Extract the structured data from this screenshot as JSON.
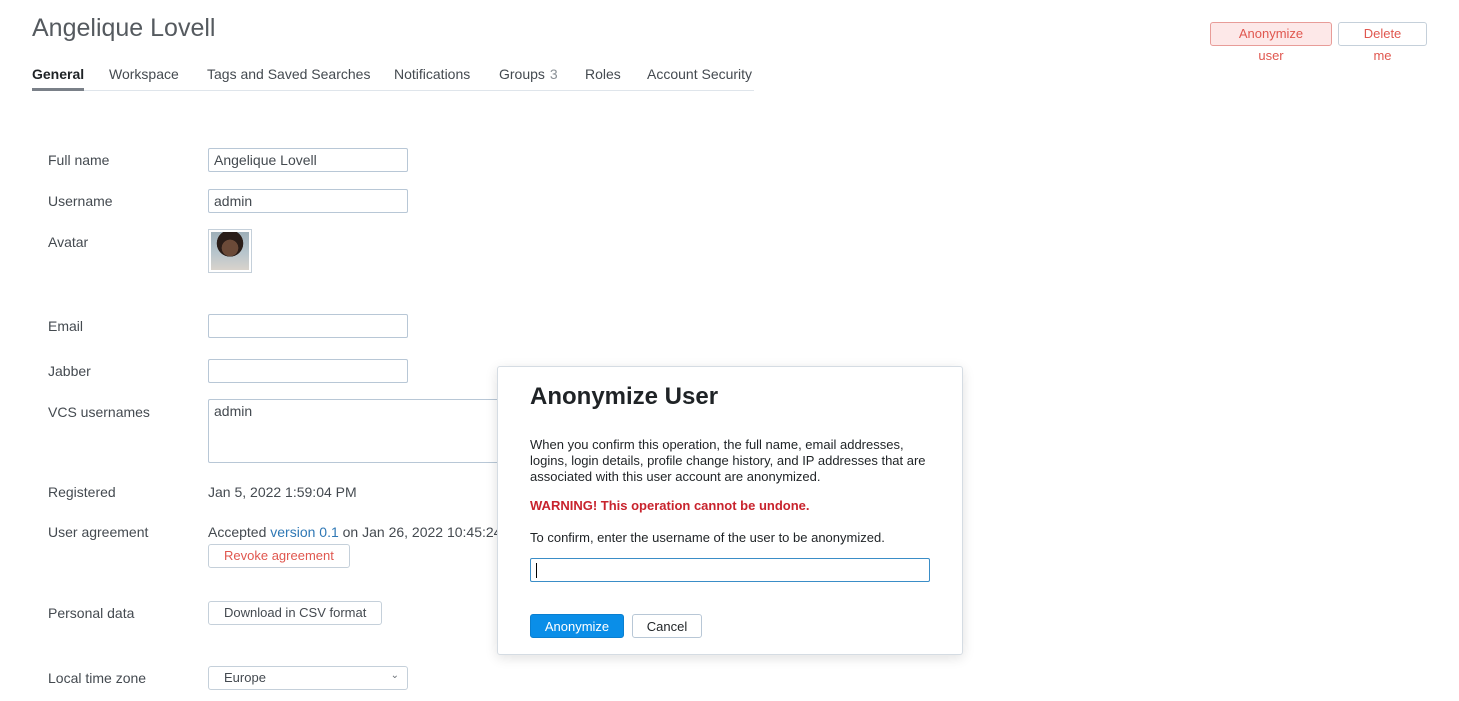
{
  "page": {
    "title": "Angelique Lovell"
  },
  "header_actions": {
    "anonymize_label": "Anonymize user",
    "delete_label": "Delete me"
  },
  "tabs": [
    {
      "label": "General",
      "active": true
    },
    {
      "label": "Workspace"
    },
    {
      "label": "Tags and Saved Searches"
    },
    {
      "label": "Notifications"
    },
    {
      "label": "Groups",
      "count": "3"
    },
    {
      "label": "Roles"
    },
    {
      "label": "Account Security"
    }
  ],
  "form": {
    "full_name": {
      "label": "Full name",
      "value": "Angelique Lovell"
    },
    "username": {
      "label": "Username",
      "value": "admin"
    },
    "avatar": {
      "label": "Avatar"
    },
    "email": {
      "label": "Email",
      "value": ""
    },
    "jabber": {
      "label": "Jabber",
      "value": ""
    },
    "vcs_usernames": {
      "label": "VCS usernames",
      "value": "admin"
    },
    "registered": {
      "label": "Registered",
      "value": "Jan 5, 2022 1:59:04 PM"
    },
    "user_agreement": {
      "label": "User agreement",
      "prefix": "Accepted",
      "link": "version 0.1",
      "suffix": "on Jan 26, 2022 10:45:24",
      "revoke_label": "Revoke agreement"
    },
    "personal_data": {
      "label": "Personal data",
      "download_label": "Download in CSV format"
    },
    "time_zone": {
      "label": "Local time zone",
      "value": "Europe"
    }
  },
  "dialog": {
    "title": "Anonymize User",
    "description": "When you confirm this operation, the full name, email addresses, logins, login details, profile change history, and IP addresses that are associated with this user account are anonymized.",
    "warning": "WARNING! This operation cannot be undone.",
    "confirm_prompt": "To confirm, enter the username of the user to be anonymized.",
    "input_value": "",
    "primary_label": "Anonymize",
    "cancel_label": "Cancel"
  }
}
